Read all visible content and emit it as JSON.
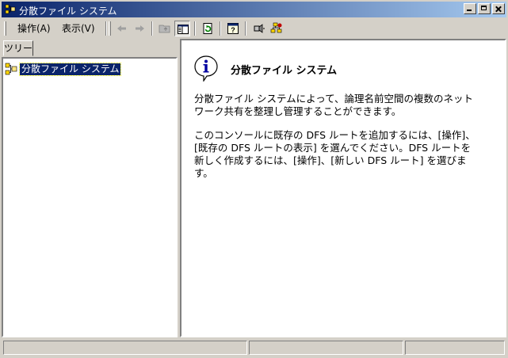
{
  "window": {
    "title": "分散ファイル システム"
  },
  "menu": {
    "action": "操作(A)",
    "view": "表示(V)"
  },
  "toolbar_icons": [
    "back-arrow-icon",
    "forward-arrow-icon",
    "up-folder-icon",
    "show-hide-tree-icon",
    "refresh-icon",
    "help-icon",
    "connect-icon",
    "dfs-icon"
  ],
  "tabs": [
    {
      "label": "ツリー"
    }
  ],
  "tree": {
    "root": "分散ファイル システム"
  },
  "content": {
    "title": "分散ファイル システム",
    "paragraphs": [
      "分散ファイル システムによって、論理名前空間の複数のネット\nワーク共有を整理し管理することができます。",
      "このコンソールに既存の DFS ルートを追加するには、[操作]、\n[既存の DFS ルートの表示] を選んでください。DFS ルートを\n新しく作成するには、[操作]、[新しい DFS ルート] を選びま\nす。"
    ]
  },
  "colors": {
    "titlebar_start": "#0a246a",
    "titlebar_end": "#a6caf0",
    "face": "#d4d0c8",
    "selection": "#0a246a"
  }
}
